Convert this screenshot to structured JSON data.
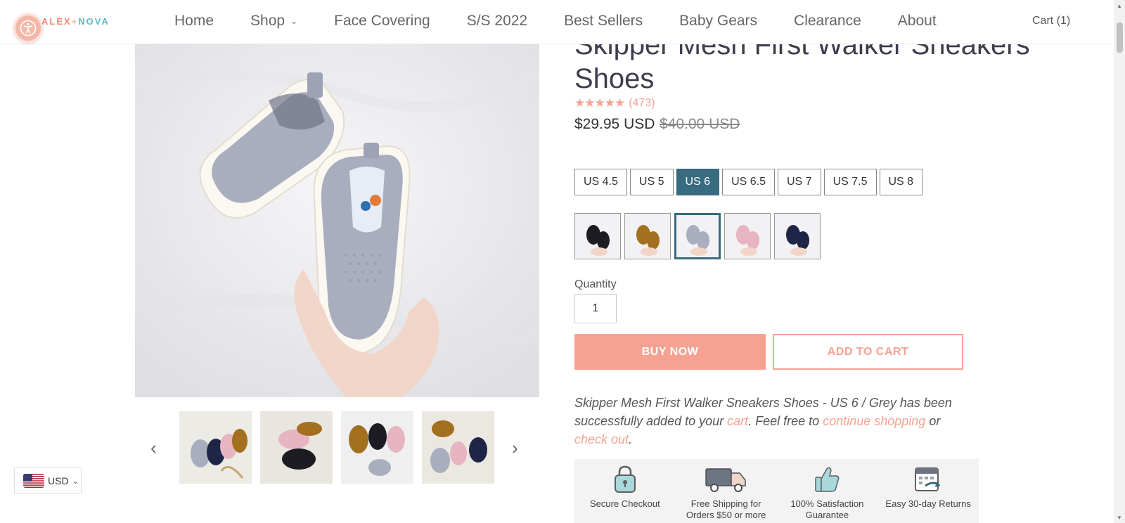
{
  "header": {
    "logo_alex": "ALEX",
    "logo_plus": "+",
    "logo_nova": "NOVA",
    "nav": [
      {
        "label": "Home"
      },
      {
        "label": "Shop"
      },
      {
        "label": "Face Covering"
      },
      {
        "label": "S/S 2022"
      },
      {
        "label": "Best Sellers"
      },
      {
        "label": "Baby Gears"
      },
      {
        "label": "Clearance"
      },
      {
        "label": "About"
      }
    ],
    "cart": "Cart (1)"
  },
  "product": {
    "title": "Skipper Mesh First Walker Sneakers Shoes",
    "rating_stars": "★★★★★",
    "rating_value": 5,
    "review_count": "(473)",
    "price": "$29.95 USD",
    "compare_price": "$40.00 USD",
    "sizes": [
      {
        "label": "US 4.5",
        "selected": false
      },
      {
        "label": "US 5",
        "selected": false
      },
      {
        "label": "US 6",
        "selected": true
      },
      {
        "label": "US 6.5",
        "selected": false
      },
      {
        "label": "US 7",
        "selected": false
      },
      {
        "label": "US 7.5",
        "selected": false
      },
      {
        "label": "US 8",
        "selected": false
      }
    ],
    "colors": [
      {
        "name": "black",
        "swatch": "#1c1c22",
        "selected": false
      },
      {
        "name": "brown",
        "swatch": "#a2701f",
        "selected": false
      },
      {
        "name": "grey",
        "swatch": "#a9aebf",
        "selected": true
      },
      {
        "name": "pink",
        "swatch": "#e7b4c1",
        "selected": false
      },
      {
        "name": "navy",
        "swatch": "#1e2546",
        "selected": false
      }
    ],
    "quantity_label": "Quantity",
    "quantity_value": "1",
    "buy_now": "BUY NOW",
    "add_to_cart": "ADD TO CART"
  },
  "cart_message": {
    "prefix": "Skipper Mesh First Walker Sneakers Shoes - US 6 / Grey has been successfully added to your ",
    "cart_link": "cart",
    "middle": ". Feel free to ",
    "continue_link": "continue shopping",
    "or": " or ",
    "checkout_link": "check out",
    "end": "."
  },
  "badges": [
    {
      "icon": "padlock-icon",
      "label": "Secure Checkout"
    },
    {
      "icon": "truck-icon",
      "label": "Free Shipping for Orders $50 or more"
    },
    {
      "icon": "thumbs-up-icon",
      "label": "100% Satisfaction Guarantee"
    },
    {
      "icon": "calendar-return-icon",
      "label": "Easy 30-day Returns"
    }
  ],
  "thumbnails": {
    "prev": "‹",
    "next": "›"
  },
  "currency": {
    "code": "USD"
  },
  "colors": {
    "accent": "#f5a292",
    "selected": "#376b80",
    "logo_alex": "#f2866f",
    "logo_nova": "#5fb8c6"
  }
}
